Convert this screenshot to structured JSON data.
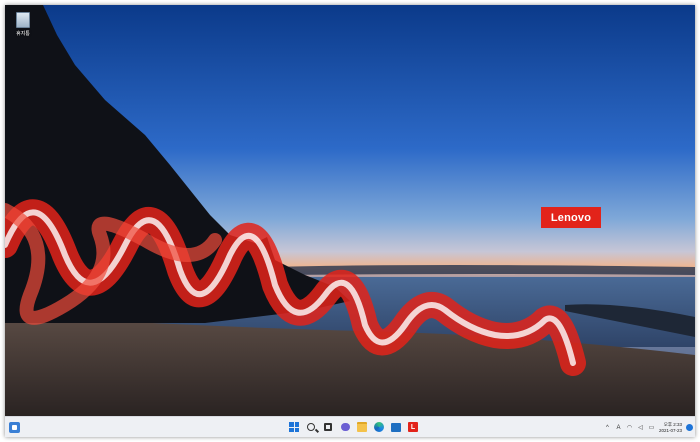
{
  "desktop": {
    "icon_label": "휴지통"
  },
  "wallpaper": {
    "brand_label": "Lenovo",
    "colors": {
      "sky_top": "#0b3a8a",
      "sky_mid": "#2d6ac8",
      "horizon": "#f1b48d",
      "sea": "#3e5a80",
      "sand": "#4a3f3a",
      "ribbon": "#e2231a"
    }
  },
  "taskbar": {
    "left_icon": "widgets-icon",
    "apps": [
      {
        "name": "start-icon"
      },
      {
        "name": "search-icon"
      },
      {
        "name": "task-view-icon"
      },
      {
        "name": "chat-icon"
      },
      {
        "name": "file-explorer-icon"
      },
      {
        "name": "edge-icon"
      },
      {
        "name": "store-icon"
      },
      {
        "name": "lenovo-vantage-icon",
        "label": "L"
      }
    ],
    "tray": {
      "chevron": "^",
      "ime": "A",
      "time": "오후 2:33",
      "date": "2021-07-23"
    }
  }
}
